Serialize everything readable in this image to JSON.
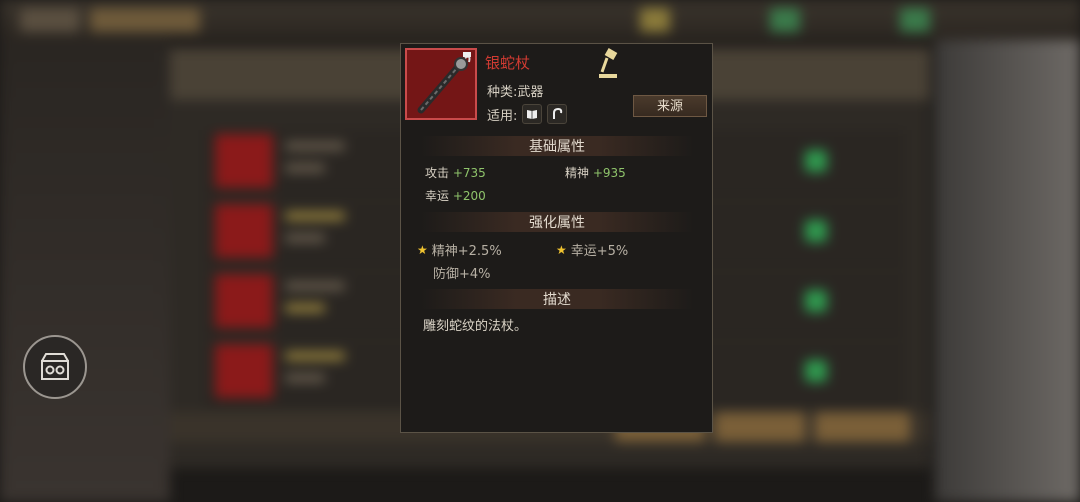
{
  "item": {
    "name": "银蛇杖",
    "type_line": "种类:武器",
    "usable_label": "适用:",
    "source_button": "来源"
  },
  "sections": {
    "base": "基础属性",
    "enhance": "强化属性",
    "description": "描述"
  },
  "base_stats": [
    {
      "label": "攻击",
      "value": "+735"
    },
    {
      "label": "精神",
      "value": "+935"
    },
    {
      "label": "幸运",
      "value": "+200"
    }
  ],
  "enhance_stats": [
    {
      "text": "精神+2.5%",
      "starred": true
    },
    {
      "text": "幸运+5%",
      "starred": true
    },
    {
      "text": "防御+4%",
      "starred": false
    }
  ],
  "description_text": "雕刻蛇纹的法杖。",
  "colors": {
    "name": "#d23b32",
    "stat_value": "#8fc46b",
    "star": "#f0c330"
  },
  "icons": [
    "snake-staff-icon",
    "hammer-icon",
    "book-icon",
    "hook-icon",
    "treasure-chest-icon",
    "star-icon"
  ]
}
